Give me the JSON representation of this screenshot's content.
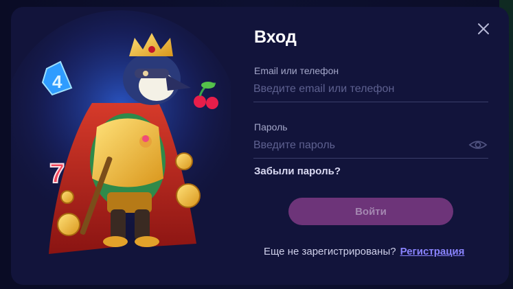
{
  "dialog": {
    "title": "Вход",
    "close_icon": "close-icon"
  },
  "form": {
    "email": {
      "label": "Email или телефон",
      "placeholder": "Введите email или телефон",
      "value": ""
    },
    "password": {
      "label": "Пароль",
      "placeholder": "Введите пароль",
      "value": "",
      "toggle_icon": "eye-icon"
    },
    "forgot_label": "Забыли пароль?",
    "submit_label": "Войти"
  },
  "footer": {
    "prompt": "Еще не зарегистрированы?",
    "register_label": "Регистрация"
  },
  "colors": {
    "modal_bg": "#12143b",
    "accent_button": "#6d3479",
    "link": "#8a84ff"
  }
}
